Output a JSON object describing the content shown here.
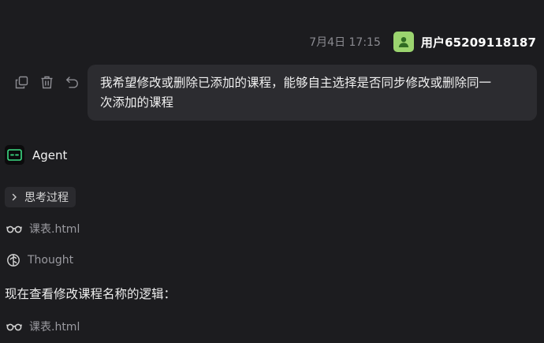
{
  "header": {
    "timestamp": "7月4日 17:15",
    "user_name": "用户65209118187",
    "avatar_icon": "user-avatar-icon",
    "avatar_color": "#9bd46f"
  },
  "message_actions": [
    {
      "icon": "copy-icon"
    },
    {
      "icon": "trash-icon"
    },
    {
      "icon": "undo-icon"
    }
  ],
  "user_message": {
    "line1": "我希望修改或删除已添加的课程，能够自主选择是否同步修改或删除同一",
    "line2": "次添加的课程"
  },
  "agent": {
    "name": "Agent",
    "logo_icon": "agent-logo-icon",
    "logo_accent": "#3ddc84"
  },
  "thinking": {
    "label": "思考过程",
    "icon": "chevron-right-icon"
  },
  "steps": [
    {
      "icon": "glasses-icon",
      "label": "课表.html"
    },
    {
      "icon": "brain-icon",
      "label": "Thought"
    },
    {
      "text": "现在查看修改课程名称的逻辑："
    },
    {
      "icon": "glasses-icon",
      "label": "课表.html"
    }
  ]
}
